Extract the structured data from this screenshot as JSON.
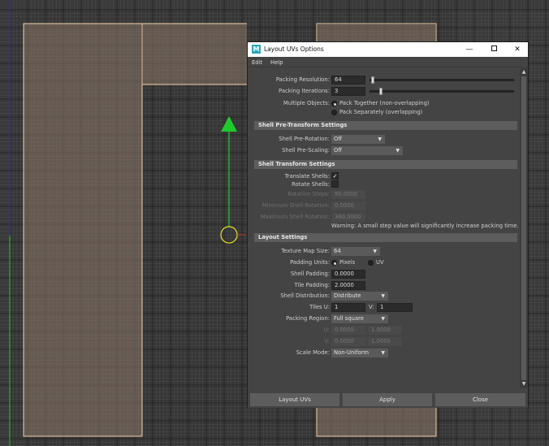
{
  "colors": {
    "background": "#3a3a3a",
    "grid_fine": "#565656",
    "grid_major": "#1e1e1e",
    "shell_fill": "#8d7867",
    "shell_edge": "#f2cfa6",
    "manipulator_arrow": "#1ecb2b",
    "manipulator_ring": "#e6e12b",
    "v_axis": "#1ec81e",
    "u_axis": "#2929d0",
    "dialog_bg": "#444444",
    "section_header": "#5d5d5d"
  },
  "viewport": {
    "manipulator": {
      "handle_icon": "move-arrow-icon",
      "pivot_icon": "pivot-ring-icon"
    }
  },
  "dialog": {
    "title": "Layout UVs Options",
    "app_icon_letter": "M",
    "window_controls": {
      "minimize": "—",
      "maximize": "□",
      "close": "✕"
    },
    "menu": [
      "Edit",
      "Help"
    ],
    "packing": {
      "resolution_label": "Packing Resolution:",
      "resolution_value": "64",
      "resolution_slider_fraction": 0.01,
      "iterations_label": "Packing Iterations:",
      "iterations_value": "3",
      "iterations_slider_fraction": 0.02,
      "multiple_objects_label": "Multiple Objects:",
      "option_together": "Pack Together (non-overlapping)",
      "option_separately": "Pack Separately (overlapping)",
      "selected": "together"
    },
    "pre_transform": {
      "header": "Shell Pre-Transform Settings",
      "rotation_label": "Shell Pre-Rotation:",
      "rotation_value": "Off",
      "scaling_label": "Shell Pre-Scaling:",
      "scaling_value": "Off"
    },
    "transform": {
      "header": "Shell Transform Settings",
      "translate_label": "Translate Shells:",
      "translate_checked": true,
      "rotate_label": "Rotate Shells:",
      "rotate_checked": false,
      "steps_label": "Rotation Steps:",
      "steps_value": "90.0000",
      "min_label": "Minimum Shell Rotation:",
      "min_value": "0.0000",
      "max_label": "Maximum Shell Rotation:",
      "max_value": "360.0000",
      "warning": "Warning: A small step value will significantly increase packing time."
    },
    "layout": {
      "header": "Layout Settings",
      "texture_label": "Texture Map Size:",
      "texture_value": "64",
      "padding_units_label": "Padding Units:",
      "unit_pixels": "Pixels",
      "unit_uv": "UV",
      "shell_padding_label": "Shell Padding:",
      "shell_padding_value": "0.0000",
      "tile_padding_label": "Tile Padding:",
      "tile_padding_value": "2.0000",
      "distribution_label": "Shell Distribution:",
      "distribution_value": "Distribute",
      "tiles_u_label": "Tiles U:",
      "tiles_u_value": "1",
      "tiles_v_label": "V:",
      "tiles_v_value": "1",
      "region_label": "Packing Region:",
      "region_value": "Full square",
      "region_u_label": "U:",
      "region_u_min": "0.0000",
      "region_u_max": "1.0000",
      "region_v_label": "V:",
      "region_v_min": "0.0000",
      "region_v_max": "1.0000",
      "scale_label": "Scale Mode:",
      "scale_value": "Non-Uniform"
    },
    "buttons": {
      "layout": "Layout UVs",
      "apply": "Apply",
      "close": "Close"
    }
  }
}
